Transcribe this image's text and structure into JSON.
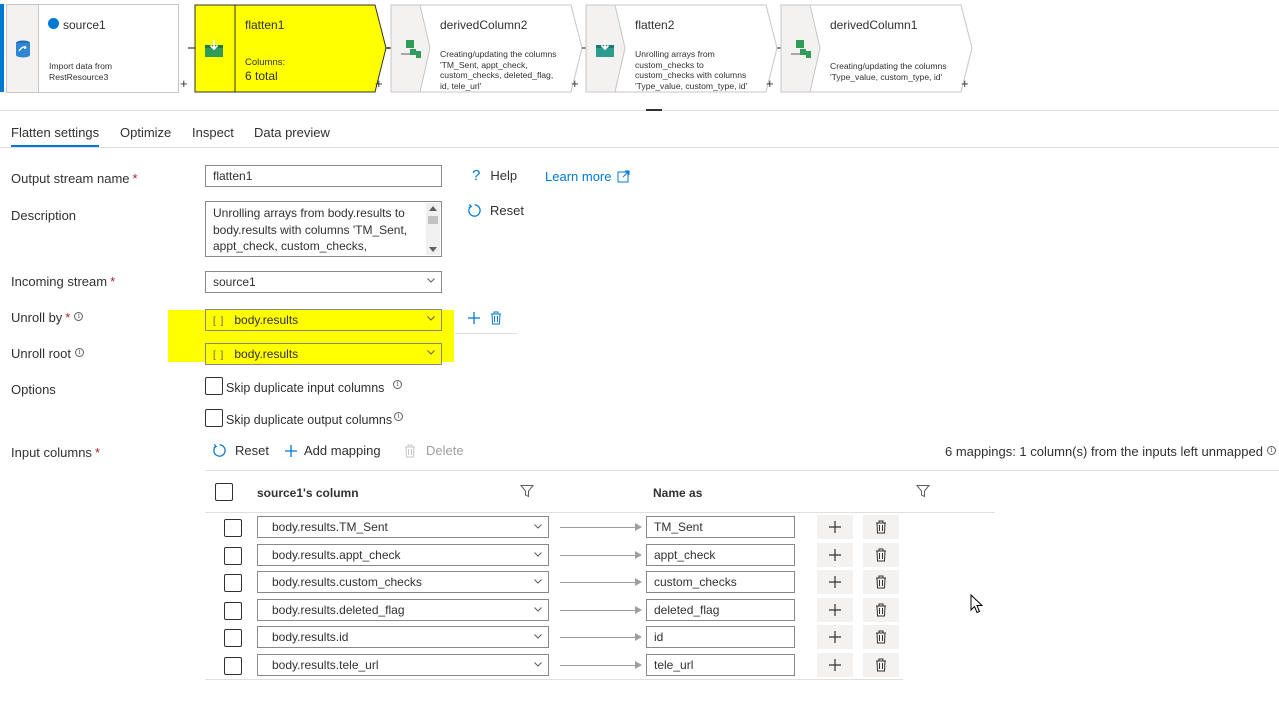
{
  "pipeline": {
    "nodes": [
      {
        "id": "source1",
        "title": "source1",
        "desc": [
          "Import data from",
          "RestResource3"
        ]
      },
      {
        "id": "flatten1",
        "title": "flatten1",
        "desc": [
          "Columns:",
          "6 total"
        ]
      },
      {
        "id": "derivedColumn2",
        "title": "derivedColumn2",
        "desc": [
          "Creating/updating the columns",
          "'TM_Sent, appt_check,",
          "custom_checks, deleted_flag,",
          "id, tele_url'"
        ]
      },
      {
        "id": "flatten2",
        "title": "flatten2",
        "desc": [
          "Unrolling arrays from",
          "custom_checks to",
          "custom_checks with columns",
          "'Type_value, custom_type, id'"
        ]
      },
      {
        "id": "derivedColumn1",
        "title": "derivedColumn1",
        "desc": [
          "Creating/updating the columns",
          "'Type_value, custom_type, id'"
        ]
      }
    ],
    "plus": "+"
  },
  "tabs": [
    {
      "label": "Flatten settings"
    },
    {
      "label": "Optimize"
    },
    {
      "label": "Inspect"
    },
    {
      "label": "Data preview"
    }
  ],
  "form": {
    "output_stream_label": "Output stream name",
    "output_stream_value": "flatten1",
    "required_mark": "*",
    "help_label": "Help",
    "learn_more_label": "Learn more",
    "description_label": "Description",
    "description_value": "Unrolling arrays from body.results to body.results with columns 'TM_Sent, appt_check, custom_checks,",
    "reset_label": "Reset",
    "incoming_stream_label": "Incoming stream",
    "incoming_stream_value": "source1",
    "unroll_by_label": "Unroll by",
    "unroll_by_value": "body.results",
    "unroll_root_label": "Unroll root",
    "unroll_root_value": "body.results",
    "json_tag": "[ ]",
    "options_label": "Options",
    "opt_skip_input": "Skip duplicate input columns",
    "opt_skip_output": "Skip duplicate output columns",
    "input_columns_label": "Input columns",
    "add_mapping_label": "Add mapping",
    "delete_label": "Delete",
    "mapping_summary": "6 mappings: 1 column(s) from the inputs left unmapped"
  },
  "table": {
    "col_source": "source1's column",
    "col_name_as": "Name as",
    "rows": [
      {
        "source": "body.results.TM_Sent",
        "name": "TM_Sent"
      },
      {
        "source": "body.results.appt_check",
        "name": "appt_check"
      },
      {
        "source": "body.results.custom_checks",
        "name": "custom_checks"
      },
      {
        "source": "body.results.deleted_flag",
        "name": "deleted_flag"
      },
      {
        "source": "body.results.id",
        "name": "id"
      },
      {
        "source": "body.results.tele_url",
        "name": "tele_url"
      }
    ]
  },
  "colors": {
    "accent": "#0078d4",
    "highlight": "#ffff00",
    "node_icon_green": "#2f9c5a"
  },
  "icons": {
    "source": "data-source-icon",
    "flatten": "flatten-icon",
    "derived": "derived-column-icon",
    "filter": "filter-icon",
    "add": "plus-icon",
    "delete": "trash-icon",
    "reset": "reset-icon",
    "external": "external-link-icon"
  }
}
